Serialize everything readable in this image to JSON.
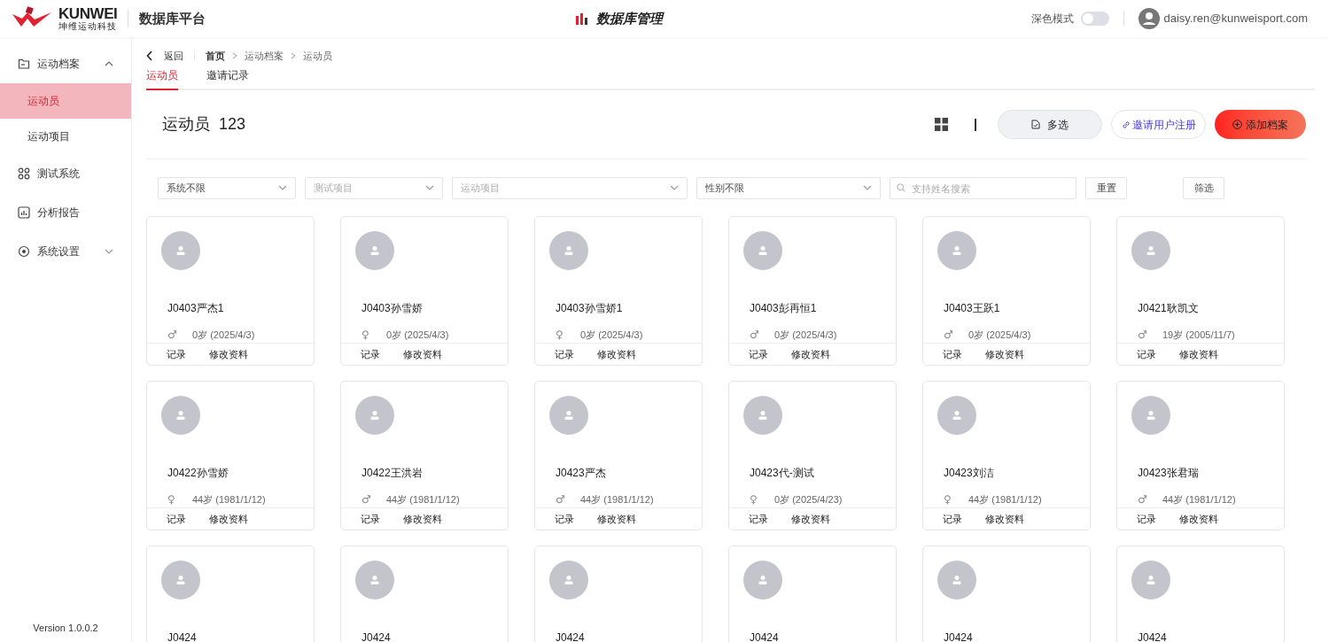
{
  "header": {
    "brand": "KUNWEI",
    "brand_sub": "坤维运动科技",
    "platform": "数据库平台",
    "page_title": "数据库管理",
    "dark_mode_label": "深色模式",
    "dark_mode": false,
    "user": "daisy.ren@kunweisport.com"
  },
  "sidebar": {
    "items": [
      {
        "label": "运动档案",
        "expanded": true,
        "children": [
          {
            "label": "运动员",
            "selected": true
          },
          {
            "label": "运动项目",
            "selected": false
          }
        ]
      },
      {
        "label": "测试系统",
        "selected": false
      },
      {
        "label": "分析报告",
        "selected": false
      },
      {
        "label": "系统设置",
        "expanded": false
      }
    ],
    "version": "Version 1.0.0.2"
  },
  "breadcrumb": {
    "back": "返回",
    "items": [
      "首页",
      "运动档案",
      "运动员"
    ]
  },
  "tabs": [
    {
      "label": "运动员",
      "selected": true
    },
    {
      "label": "邀请记录",
      "selected": false
    }
  ],
  "heading": {
    "title": "运动员",
    "count": "123"
  },
  "actions": {
    "multi_select": "多选",
    "invite": "邀请用户注册",
    "add": "添加档案"
  },
  "filters": {
    "system": {
      "value": "系统不限"
    },
    "test_item": {
      "placeholder": "测试项目"
    },
    "sport": {
      "placeholder": "运动项目"
    },
    "gender": {
      "value": "性别不限"
    },
    "search": {
      "placeholder": "支持姓名搜索"
    },
    "reset": "重置",
    "filter": "筛选"
  },
  "athletes": [
    {
      "name": "J0403严杰1",
      "gender": "♂",
      "age": "0岁 (2025/4/3)",
      "actions": [
        "记录",
        "修改资料"
      ]
    },
    {
      "name": "J0403孙雪娇",
      "gender": "♀",
      "age": "0岁 (2025/4/3)",
      "actions": [
        "记录",
        "修改资料"
      ]
    },
    {
      "name": "J0403孙雪娇1",
      "gender": "♀",
      "age": "0岁 (2025/4/3)",
      "actions": [
        "记录",
        "修改资料"
      ]
    },
    {
      "name": "J0403彭再恒1",
      "gender": "♂",
      "age": "0岁 (2025/4/3)",
      "actions": [
        "记录",
        "修改资料"
      ]
    },
    {
      "name": "J0403王跃1",
      "gender": "♂",
      "age": "0岁 (2025/4/3)",
      "actions": [
        "记录",
        "修改资料"
      ]
    },
    {
      "name": "J0421耿凯文",
      "gender": "♂",
      "age": "19岁 (2005/11/7)",
      "actions": [
        "记录",
        "修改资料"
      ]
    },
    {
      "name": "J0422孙雪娇",
      "gender": "♀",
      "age": "44岁 (1981/1/12)",
      "actions": [
        "记录",
        "修改资料"
      ]
    },
    {
      "name": "J0422王洪岩",
      "gender": "♂",
      "age": "44岁 (1981/1/12)",
      "actions": [
        "记录",
        "修改资料"
      ]
    },
    {
      "name": "J0423严杰",
      "gender": "♂",
      "age": "44岁 (1981/1/12)",
      "actions": [
        "记录",
        "修改资料"
      ]
    },
    {
      "name": "J0423代-测试",
      "gender": "♀",
      "age": "0岁 (2025/4/23)",
      "actions": [
        "记录",
        "修改资料"
      ]
    },
    {
      "name": "J0423刘洁",
      "gender": "♀",
      "age": "44岁 (1981/1/12)",
      "actions": [
        "记录",
        "修改资料"
      ]
    },
    {
      "name": "J0423张君瑞",
      "gender": "♂",
      "age": "44岁 (1981/1/12)",
      "actions": [
        "记录",
        "修改资料"
      ]
    },
    {
      "name": "J0424"
    },
    {
      "name": "J0424"
    },
    {
      "name": "J0424"
    },
    {
      "name": "J0424"
    },
    {
      "name": "J0424"
    },
    {
      "name": "J0424"
    }
  ]
}
